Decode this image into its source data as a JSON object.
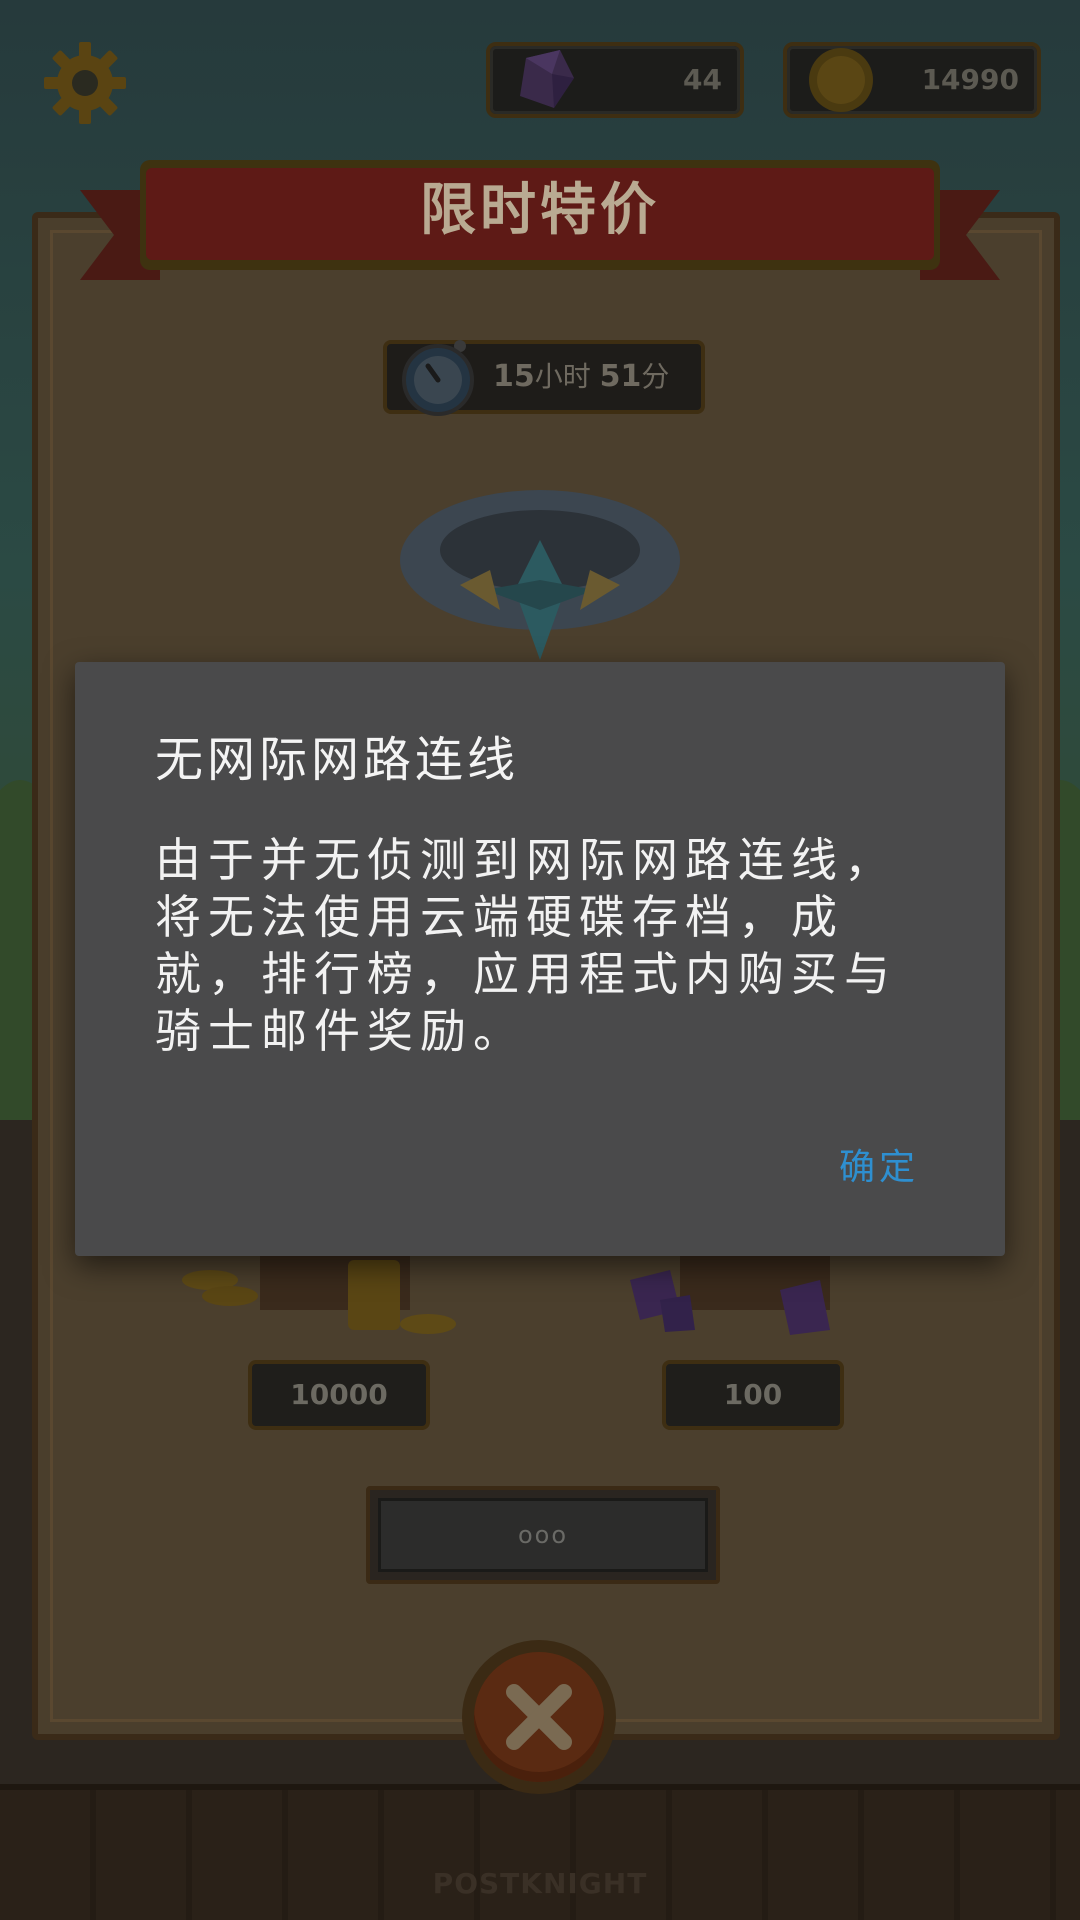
{
  "hud": {
    "gems": "44",
    "coins": "14990",
    "settings_icon": "gear-icon",
    "gem_icon": "purple-gem-icon",
    "coin_icon": "gold-coin-icon"
  },
  "shop": {
    "title": "限时特价",
    "timer": {
      "hours": "15",
      "hours_unit": "小时",
      "minutes": "51",
      "minutes_unit": "分"
    },
    "offer_icon": "crystal-ring-icon",
    "items": [
      {
        "icon": "coin-barrel-icon",
        "amount": "10000"
      },
      {
        "icon": "gem-barrel-icon",
        "amount": "100"
      }
    ],
    "buy_button": "ooo",
    "close_icon": "close-icon"
  },
  "dialog": {
    "title": "无网际网路连线",
    "message": "由于并无侦测到网际网路连线，将无法使用云端硬碟存档，成就，排行榜，应用程式内购买与骑士邮件奖励。",
    "confirm": "确定"
  },
  "footer": {
    "logo": "POSTKNIGHT"
  },
  "colors": {
    "dim_overlay": "#000000",
    "ribbon_red": "#5e1a16",
    "dialog_bg": "#4a4a4b",
    "confirm_blue": "#2e8fd0"
  }
}
